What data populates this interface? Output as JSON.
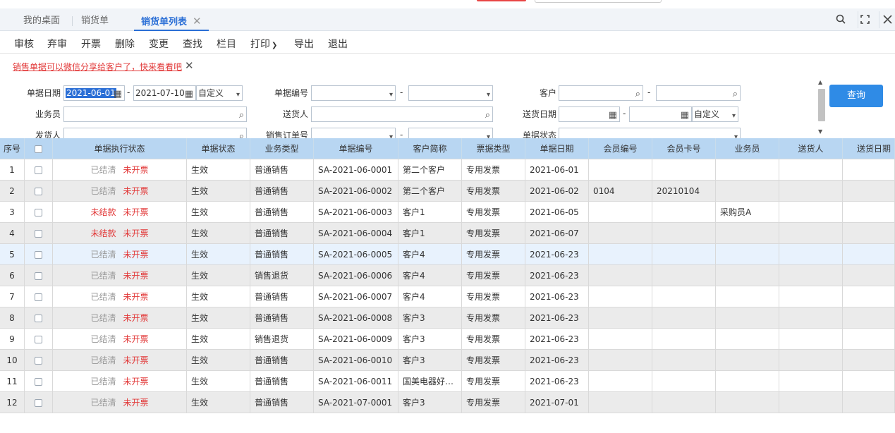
{
  "tabs": [
    {
      "label": "我的桌面"
    },
    {
      "label": "销货单"
    },
    {
      "label": "销货单列表"
    }
  ],
  "toolbar": [
    "审核",
    "弃审",
    "开票",
    "删除",
    "变更",
    "查找",
    "栏目",
    "打印",
    "导出",
    "退出"
  ],
  "notice": "销售单据可以微信分享给客户了，快来看看吧",
  "filters": {
    "doc_date_label": "单据日期",
    "date_from": "2021-06-01",
    "date_to": "2021-07-10",
    "date_mode": "自定义",
    "doc_no_label": "单据编号",
    "customer_label": "客户",
    "salesman_label": "业务员",
    "deliverer_label": "送货人",
    "delivery_date_label": "送货日期",
    "delivery_date_mode": "自定义",
    "shipper_label": "发货人",
    "sales_order_no_label": "销售订单号",
    "doc_status_label": "单据状态",
    "query_label": "查询"
  },
  "columns": [
    "序号",
    "",
    "单据执行状态",
    "单据状态",
    "业务类型",
    "单据编号",
    "客户简称",
    "票据类型",
    "单据日期",
    "会员编号",
    "会员卡号",
    "业务员",
    "送货人",
    "送货日期"
  ],
  "rows": [
    {
      "no": "1",
      "exec": "已结清",
      "exec_red": false,
      "invoice": "未开票",
      "status": "生效",
      "biz": "普通销售",
      "doc_no": "SA-2021-06-0001",
      "customer": "第二个客户",
      "ticket": "专用发票",
      "date": "2021-06-01",
      "member_no": "",
      "card_no": "",
      "salesman": "",
      "deliverer": "",
      "delivery_date": ""
    },
    {
      "no": "2",
      "exec": "已结清",
      "exec_red": false,
      "invoice": "未开票",
      "status": "生效",
      "biz": "普通销售",
      "doc_no": "SA-2021-06-0002",
      "customer": "第二个客户",
      "ticket": "专用发票",
      "date": "2021-06-02",
      "member_no": "0104",
      "card_no": "20210104",
      "salesman": "",
      "deliverer": "",
      "delivery_date": ""
    },
    {
      "no": "3",
      "exec": "未结款",
      "exec_red": true,
      "invoice": "未开票",
      "status": "生效",
      "biz": "普通销售",
      "doc_no": "SA-2021-06-0003",
      "customer": "客户1",
      "ticket": "专用发票",
      "date": "2021-06-05",
      "member_no": "",
      "card_no": "",
      "salesman": "采购员A",
      "deliverer": "",
      "delivery_date": ""
    },
    {
      "no": "4",
      "exec": "未结款",
      "exec_red": true,
      "invoice": "未开票",
      "status": "生效",
      "biz": "普通销售",
      "doc_no": "SA-2021-06-0004",
      "customer": "客户1",
      "ticket": "专用发票",
      "date": "2021-06-07",
      "member_no": "",
      "card_no": "",
      "salesman": "",
      "deliverer": "",
      "delivery_date": ""
    },
    {
      "no": "5",
      "exec": "已结清",
      "exec_red": false,
      "invoice": "未开票",
      "status": "生效",
      "biz": "普通销售",
      "doc_no": "SA-2021-06-0005",
      "customer": "客户4",
      "ticket": "专用发票",
      "date": "2021-06-23",
      "member_no": "",
      "card_no": "",
      "salesman": "",
      "deliverer": "",
      "delivery_date": ""
    },
    {
      "no": "6",
      "exec": "已结清",
      "exec_red": false,
      "invoice": "未开票",
      "status": "生效",
      "biz": "销售退货",
      "doc_no": "SA-2021-06-0006",
      "customer": "客户4",
      "ticket": "专用发票",
      "date": "2021-06-23",
      "member_no": "",
      "card_no": "",
      "salesman": "",
      "deliverer": "",
      "delivery_date": ""
    },
    {
      "no": "7",
      "exec": "已结清",
      "exec_red": false,
      "invoice": "未开票",
      "status": "生效",
      "biz": "普通销售",
      "doc_no": "SA-2021-06-0007",
      "customer": "客户4",
      "ticket": "专用发票",
      "date": "2021-06-23",
      "member_no": "",
      "card_no": "",
      "salesman": "",
      "deliverer": "",
      "delivery_date": ""
    },
    {
      "no": "8",
      "exec": "已结清",
      "exec_red": false,
      "invoice": "未开票",
      "status": "生效",
      "biz": "普通销售",
      "doc_no": "SA-2021-06-0008",
      "customer": "客户3",
      "ticket": "专用发票",
      "date": "2021-06-23",
      "member_no": "",
      "card_no": "",
      "salesman": "",
      "deliverer": "",
      "delivery_date": ""
    },
    {
      "no": "9",
      "exec": "已结清",
      "exec_red": false,
      "invoice": "未开票",
      "status": "生效",
      "biz": "销售退货",
      "doc_no": "SA-2021-06-0009",
      "customer": "客户3",
      "ticket": "专用发票",
      "date": "2021-06-23",
      "member_no": "",
      "card_no": "",
      "salesman": "",
      "deliverer": "",
      "delivery_date": ""
    },
    {
      "no": "10",
      "exec": "已结清",
      "exec_red": false,
      "invoice": "未开票",
      "status": "生效",
      "biz": "普通销售",
      "doc_no": "SA-2021-06-0010",
      "customer": "客户3",
      "ticket": "专用发票",
      "date": "2021-06-23",
      "member_no": "",
      "card_no": "",
      "salesman": "",
      "deliverer": "",
      "delivery_date": ""
    },
    {
      "no": "11",
      "exec": "已结清",
      "exec_red": false,
      "invoice": "未开票",
      "status": "生效",
      "biz": "普通销售",
      "doc_no": "SA-2021-06-0011",
      "customer": "国美电器好…",
      "ticket": "专用发票",
      "date": "2021-06-23",
      "member_no": "",
      "card_no": "",
      "salesman": "",
      "deliverer": "",
      "delivery_date": ""
    },
    {
      "no": "12",
      "exec": "已结清",
      "exec_red": false,
      "invoice": "未开票",
      "status": "生效",
      "biz": "普通销售",
      "doc_no": "SA-2021-07-0001",
      "customer": "客户3",
      "ticket": "专用发票",
      "date": "2021-07-01",
      "member_no": "",
      "card_no": "",
      "salesman": "",
      "deliverer": "",
      "delivery_date": ""
    }
  ],
  "highlighted_row": 5
}
